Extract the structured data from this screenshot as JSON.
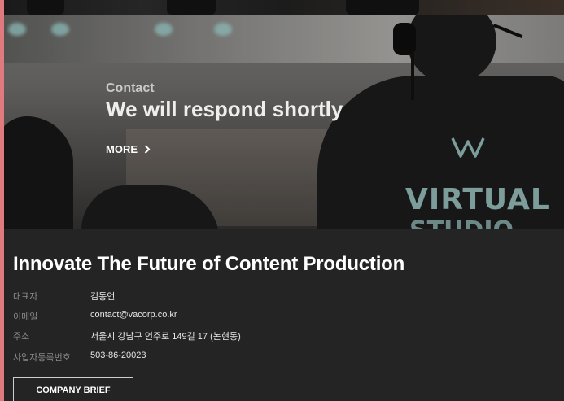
{
  "hero": {
    "eyebrow": "Contact",
    "headline": "We will respond shortly",
    "more_label": "MORE",
    "backdrop_text": "VIRTUAL",
    "backdrop_text2": "STUDIO"
  },
  "info": {
    "title": "Innovate The Future of Content Production",
    "rows": [
      {
        "label": "대표자",
        "value": "김동언"
      },
      {
        "label": "이메일",
        "value": "contact@vacorp.co.kr"
      },
      {
        "label": "주소",
        "value": "서울시 강남구 언주로 149길 17 (논현동)"
      },
      {
        "label": "사업자등록번호",
        "value": "503-86-20023"
      }
    ],
    "brief_label": "COMPANY BRIEF"
  },
  "colors": {
    "frame_accent": "#e07a7e",
    "section_bg": "#242424",
    "backdrop_teal": "#8fb3b0"
  }
}
